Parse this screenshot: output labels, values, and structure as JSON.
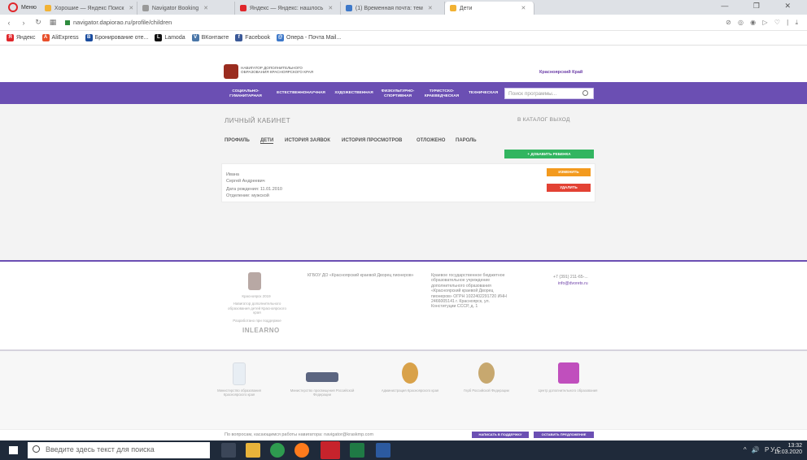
{
  "browser": {
    "opera_label": "Меню",
    "tabs": [
      {
        "label": "Хорошие — Яндекс Поиск",
        "color": "#f2b233"
      },
      {
        "label": "Navigator Booking",
        "color": "#999999"
      },
      {
        "label": "Яндекс — Яндекс: нашлось",
        "color": "#e0262b"
      },
      {
        "label": "(1) Временная почта: тем",
        "color": "#3d78c9"
      },
      {
        "label": "Дети",
        "color": "#f2b233"
      }
    ],
    "url": "navigator.dapiorao.ru/profile/children",
    "window_controls": "— ❐ ✕",
    "bookmarks": [
      {
        "label": "Яндекс",
        "icon": "Я",
        "color": "#e0262b"
      },
      {
        "label": "AliExpress",
        "icon": "A",
        "color": "#e8502c"
      },
      {
        "label": "Бронирование оте...",
        "icon": "B",
        "color": "#1a4c9e"
      },
      {
        "label": "Lamoda",
        "icon": "L",
        "color": "#111111"
      },
      {
        "label": "ВКонтакте",
        "icon": "V",
        "color": "#4a76a8"
      },
      {
        "label": "Facebook",
        "icon": "f",
        "color": "#3b5998"
      },
      {
        "label": "Опера - Почта Mail...",
        "icon": "@",
        "color": "#3d78c9"
      }
    ]
  },
  "site": {
    "logo_text": "НАВИГАТОР ДОПОЛНИТЕЛЬНОГО ОБРАЗОВАНИЯ КРАСНОЯРСКОГО КРАЯ",
    "reg_link": "Красноярский Край",
    "nav": [
      "СОЦИАЛЬНО-ГУМАНИТАРНАЯ",
      "ЕСТЕСТВЕННОНАУЧНАЯ",
      "ХУДОЖЕСТВЕННАЯ",
      "ФИЗКУЛЬТУРНО-СПОРТИВНАЯ",
      "ТУРИСТСКО-КРАЕВЕДЧЕСКАЯ",
      "ТЕХНИЧЕСКАЯ"
    ],
    "search_placeholder": "Поиск программы..."
  },
  "cabinet": {
    "title": "ЛИЧНЫЙ КАБИНЕТ",
    "top_links": "В КАТАЛОГ    ВЫХОД",
    "tabs": [
      "ПРОФИЛЬ",
      "ДЕТИ",
      "ИСТОРИЯ ЗАЯВОК",
      "ИСТОРИЯ ПРОСМОТРОВ",
      "ОТЛОЖЕНО",
      "ПАРОЛЬ"
    ],
    "active_tab": "ДЕТИ",
    "add_child_label": "+ ДОБАВИТЬ РЕБЕНКА",
    "child": {
      "name": "Ивана",
      "line2": "Сергей Андреевич",
      "line3": "Дата рождения: 11.01.2010",
      "line4": "Отделение: мужской"
    },
    "edit_label": "ИЗМЕНИТЬ",
    "delete_label": "УДАЛИТЬ"
  },
  "footer": {
    "left_caption": "Красноярск 2019",
    "left_desc": "Навигатор дополнительного образования детей Красноярского края",
    "left_powered": "Разработано при поддержке",
    "inlearno": "INLEARNO",
    "col1": "КГБОУ ДО «Красноярский краевой Дворец пионеров»",
    "col2": "Краевое государственное бюджетное образовательное учреждение дополнительного образования «Красноярский краевой Дворец пионеров» ОГРН 1022402291720 ИНН 2466005141 г. Красноярск, ул. Конституции СССР, д. 1",
    "col3_line1": "+7 (391) 211-65-...",
    "col3_line2": "info@dvorets.ru",
    "partners": [
      "Министерство образования Красноярского края",
      "Министерство просвещения Российской Федерации",
      "Администрация Красноярского края",
      "Герб Российской Федерации",
      "Центр дополнительного образования"
    ],
    "bottom_text": "По вопросам, касающимся работы навигатора: navigator@kraskmp.com",
    "bottom_btn1": "НАПИСАТЬ В ПОДДЕРЖКУ",
    "bottom_btn2": "ОСТАВИТЬ ПРЕДЛОЖЕНИЕ"
  },
  "taskbar": {
    "search_placeholder": "Введите здесь текст для поиска",
    "tray": "^  🔊  РУС",
    "time": "13:32",
    "date": "11.03.2020"
  }
}
